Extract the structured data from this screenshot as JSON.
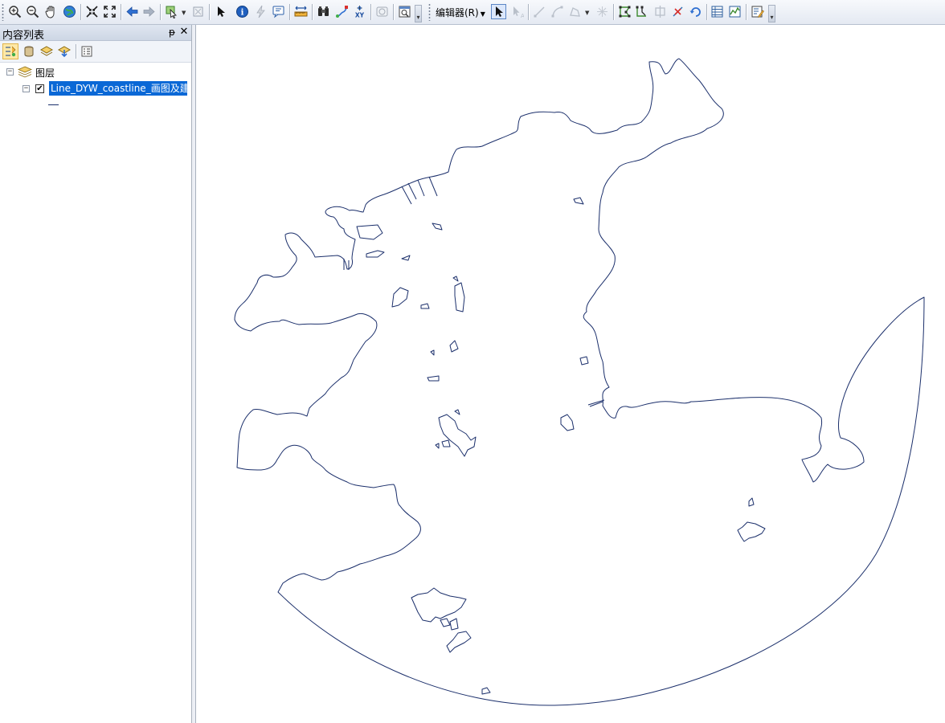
{
  "toolbar": {
    "editor_menu_label": "编辑器(R)",
    "tools": [
      "zoom-in",
      "zoom-out",
      "pan",
      "full-extent",
      "fixed-zoom-in",
      "fixed-zoom-out",
      "go-back",
      "go-forward",
      "select-features",
      "clear-selection",
      "select-elements",
      "identify",
      "hyperlink",
      "html-popup",
      "measure",
      "find",
      "go-to-xy",
      "time-slider",
      "create-viewer-window",
      "edit-tool",
      "edit-annotation",
      "straight-segment",
      "endpoint-arc",
      "trace",
      "point",
      "edit-vertices",
      "reshape-feature",
      "cut-polygons",
      "split-tool",
      "rotate-tool",
      "attributes",
      "sketch-properties",
      "create-features"
    ]
  },
  "toc": {
    "title": "内容列表",
    "pin_glyph": "ᵽ",
    "close_glyph": "✕",
    "root_label": "图层",
    "layer_label": "Line_DYW_coastline_画图及建模",
    "layer_checked": "✔",
    "expander_minus": "−"
  },
  "map": {
    "line_color": "#1b2f6b",
    "background": "#ffffff"
  }
}
